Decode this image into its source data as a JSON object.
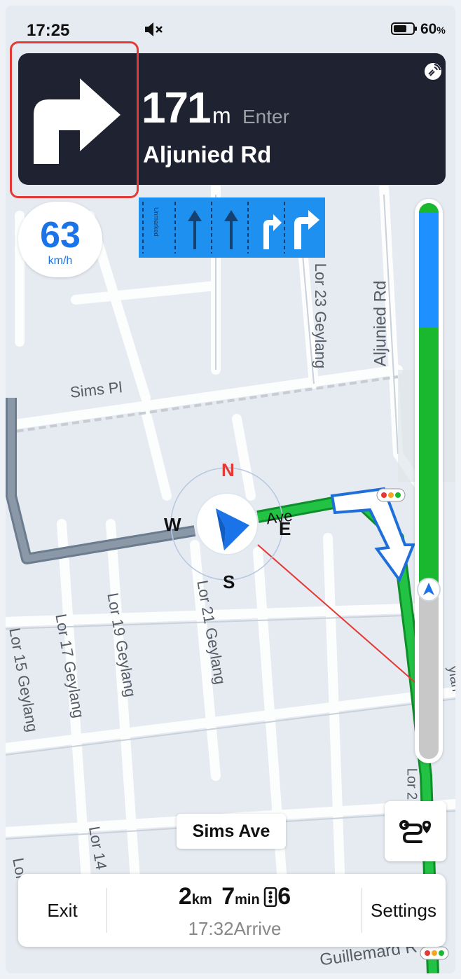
{
  "status_bar": {
    "time": "17:25",
    "battery_percent": "60",
    "battery_unit": "%",
    "mute_icon": "speaker-muted-icon"
  },
  "guidance": {
    "distance": "171",
    "distance_unit": "m",
    "action": "Enter",
    "road_name": "Aljunied Rd",
    "turn_icon": "turn-right-icon"
  },
  "lanes": {
    "unmarked_label": "Unmarked",
    "lanes": [
      "unmarked",
      "straight",
      "straight",
      "straight-right",
      "right"
    ]
  },
  "speed": {
    "value": "63",
    "unit": "km/h"
  },
  "compass": {
    "north": "N",
    "south": "S",
    "east": "E",
    "west": "W"
  },
  "map_labels": {
    "sims_pl": "Sims Pl",
    "aljunied_rd": "Aljunied Rd",
    "lor23": "Lor 23 Geylang",
    "lor21": "Lor 21 Geylang",
    "lor19": "Lor 19 Geylang",
    "lor17": "Lor 17 Geylang",
    "lor15": "Lor 15 Geylang",
    "lor14": "Lor 14",
    "lor_bottom": "Lor",
    "guillemard": "Guillemard R",
    "ave_label": "Ave",
    "lor_right": "Lor 2",
    "geylang_partial": "ylan"
  },
  "route_progress": {
    "traveled_fraction": 0.0,
    "colors": {
      "blue": "#1e90ff",
      "green": "#19b82e",
      "gray": "#c8c8c8"
    }
  },
  "current_street": "Sims Ave",
  "bottom_bar": {
    "exit_label": "Exit",
    "distance_value": "2",
    "distance_unit": "km",
    "time_value": "7",
    "time_unit": "min",
    "traffic_lights_count": "6",
    "arrive_time": "17:32",
    "arrive_label": "Arrive",
    "settings_label": "Settings"
  },
  "colors": {
    "nav_card": "#1f2230",
    "accent_blue": "#1a73e8",
    "route_green": "#19b82e",
    "highlight_red": "#e53935"
  }
}
